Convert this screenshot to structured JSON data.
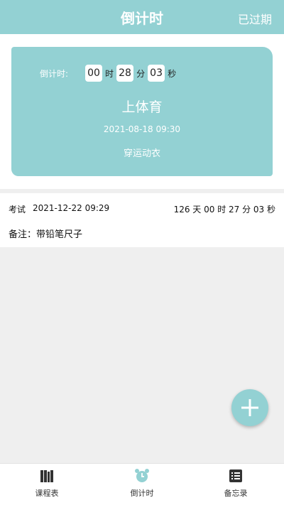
{
  "header": {
    "title": "倒计时",
    "action": "已过期"
  },
  "card": {
    "countdown_label": "倒计时:",
    "hours": "00",
    "hours_unit": "时",
    "minutes": "28",
    "minutes_unit": "分",
    "seconds": "03",
    "seconds_unit": "秒",
    "title": "上体育",
    "time": "2021-08-18 09:30",
    "note": "穿运动衣"
  },
  "item": {
    "type": "考试",
    "datetime": "2021-12-22 09:29",
    "remaining": "126 天 00 时 27 分 03 秒",
    "note": "备注：带铅笔尺子"
  },
  "tabs": [
    {
      "label": "课程表",
      "icon": "timetable-icon"
    },
    {
      "label": "倒计时",
      "icon": "alarm-clock-icon"
    },
    {
      "label": "备忘录",
      "icon": "memo-icon"
    }
  ],
  "colors": {
    "accent": "#93d1d3",
    "background": "#efefef"
  }
}
